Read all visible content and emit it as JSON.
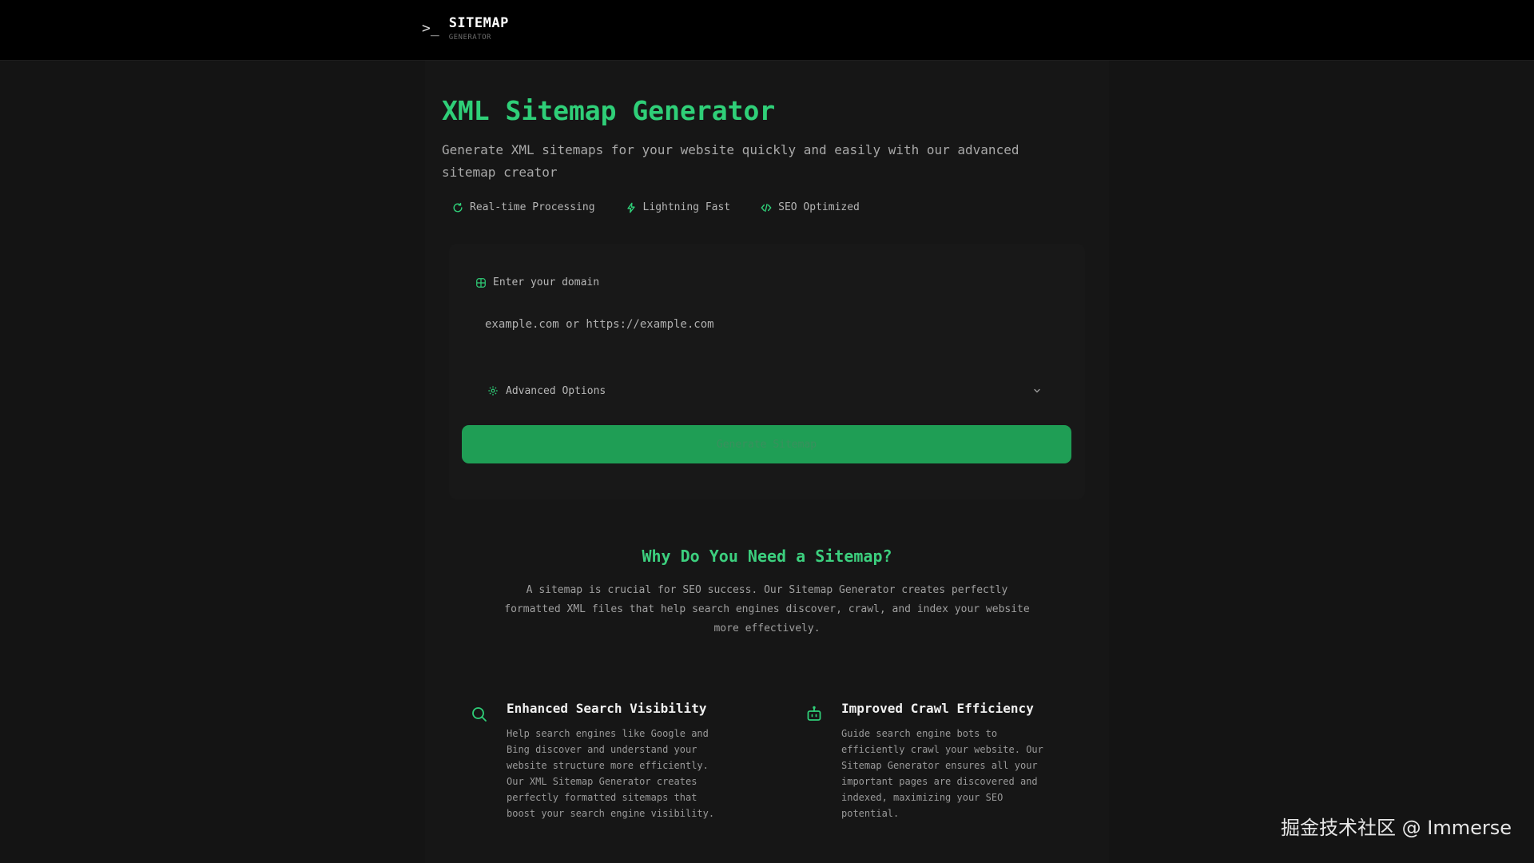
{
  "header": {
    "logo_icon": ">_",
    "title": "SITEMAP",
    "subtitle": "GENERATOR"
  },
  "hero": {
    "title": "XML Sitemap Generator",
    "description": "Generate XML sitemaps for your website quickly and easily with our advanced sitemap creator"
  },
  "features": [
    {
      "icon": "refresh-icon",
      "label": "Real-time Processing"
    },
    {
      "icon": "lightning-icon",
      "label": "Lightning Fast"
    },
    {
      "icon": "code-icon",
      "label": "SEO Optimized"
    }
  ],
  "form": {
    "domain_label": "Enter your domain",
    "domain_placeholder": "example.com or https://example.com",
    "domain_value": "",
    "advanced_label": "Advanced Options",
    "generate_label": "Generate Sitemap"
  },
  "why": {
    "title": "Why Do You Need a Sitemap?",
    "description": "A sitemap is crucial for SEO success. Our Sitemap Generator creates perfectly formatted XML files that help search engines discover, crawl, and index your website more effectively."
  },
  "benefits": [
    {
      "icon": "search-icon",
      "title": "Enhanced Search Visibility",
      "description": "Help search engines like Google and Bing discover and understand your website structure more efficiently. Our XML Sitemap Generator creates perfectly formatted sitemaps that boost your search engine visibility."
    },
    {
      "icon": "bot-icon",
      "title": "Improved Crawl Efficiency",
      "description": "Guide search engine bots to efficiently crawl your website. Our Sitemap Generator ensures all your important pages are discovered and indexed, maximizing your SEO potential."
    }
  ],
  "watermark": "掘金技术社区 @ Immerse",
  "colors": {
    "accent": "#2fcf78",
    "button": "#1f9e55",
    "background": "#141414",
    "topbar": "#000000"
  }
}
